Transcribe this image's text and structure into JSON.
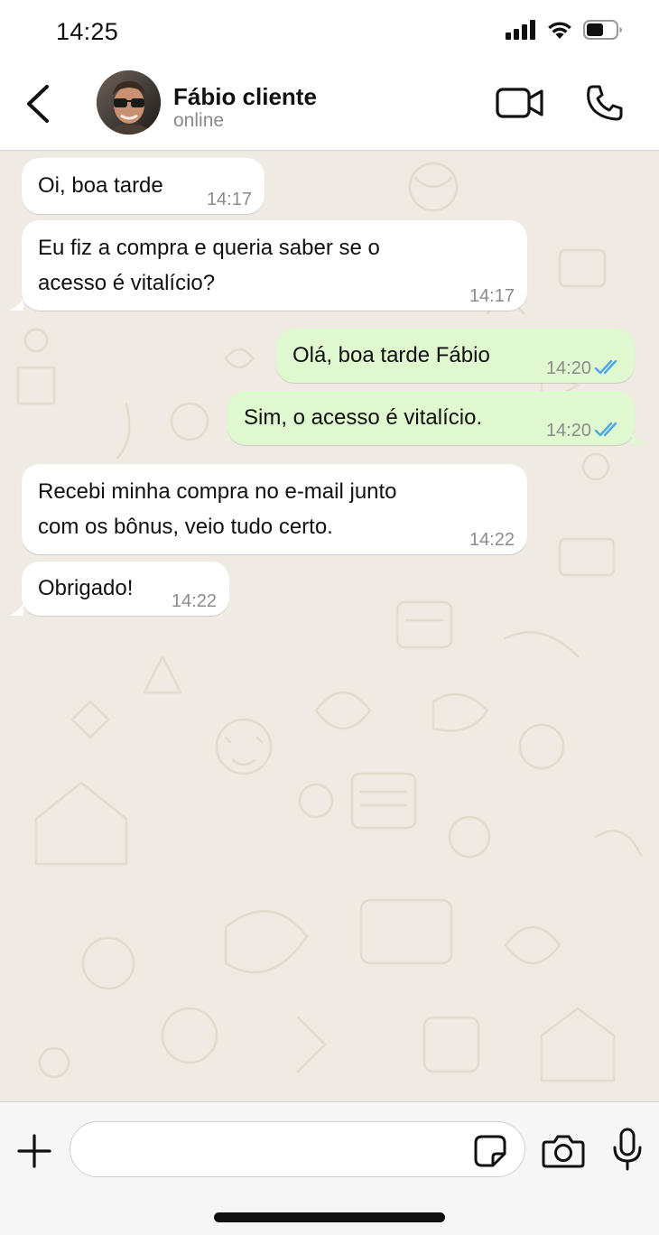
{
  "status_bar": {
    "time": "14:25",
    "icons": [
      "signal-icon",
      "wifi-icon",
      "battery-icon"
    ]
  },
  "header": {
    "contact_name": "Fábio cliente",
    "contact_status": "online",
    "icons": [
      "back-chevron-icon",
      "video-call-icon",
      "phone-icon"
    ]
  },
  "messages": [
    {
      "direction": "in",
      "text": "Oi, boa tarde",
      "time": "14:17"
    },
    {
      "direction": "in",
      "text": "Eu fiz a compra e queria saber se o\nacesso é vitalício?",
      "time": "14:17"
    },
    {
      "direction": "out",
      "text": "Olá, boa tarde Fábio",
      "time": "14:20",
      "status": "read"
    },
    {
      "direction": "out",
      "text": "Sim, o acesso é vitalício.",
      "time": "14:20",
      "status": "read"
    },
    {
      "direction": "in",
      "text": "Recebi minha compra no e-mail junto\ncom os bônus, veio tudo certo.",
      "time": "14:22"
    },
    {
      "direction": "in",
      "text": "Obrigado!",
      "time": "14:22"
    }
  ],
  "input_bar": {
    "placeholder": "",
    "value": "",
    "icons": [
      "plus-icon",
      "sticker-icon",
      "camera-icon",
      "microphone-icon"
    ]
  },
  "colors": {
    "chat_background": "#efeae2",
    "incoming_bubble": "#ffffff",
    "outgoing_bubble": "#e0f8cf",
    "read_ticks": "#4fa6e8"
  }
}
